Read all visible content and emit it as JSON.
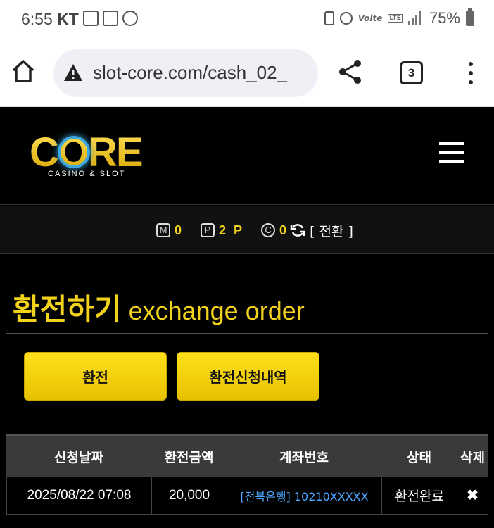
{
  "status_bar": {
    "time": "6:55",
    "carrier": "KT",
    "volte": "Volte",
    "lte": "LTE",
    "battery": "75%"
  },
  "browser": {
    "url": "slot-core.com/cash_02_",
    "tab_count": "3"
  },
  "header": {
    "logo_text": "CORE",
    "logo_sub": "CASINO & SLOT"
  },
  "balance": {
    "m_label": "M",
    "m_value": "0",
    "p_label": "P",
    "p_value": "2 P",
    "c_label": "C",
    "c_value": "0",
    "convert_label": "[ 전환 ]"
  },
  "page": {
    "title_ko": "환전하기",
    "title_en": "exchange order"
  },
  "buttons": {
    "exchange": "환전",
    "history": "환전신청내역"
  },
  "table": {
    "headers": [
      "신청날짜",
      "환전금액",
      "계좌번호",
      "상태",
      "삭제"
    ],
    "rows": [
      {
        "date": "2025/08/22 07:08",
        "amount": "20,000",
        "account": "[전북은행] 10210XXXXX",
        "status": "환전완료",
        "delete": "✖"
      }
    ]
  }
}
